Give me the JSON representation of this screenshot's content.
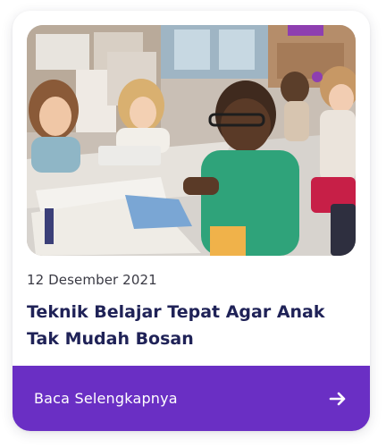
{
  "article": {
    "image_alt": "classroom-children-studying",
    "date": "12 Desember 2021",
    "title": "Teknik Belajar Tepat Agar Anak Tak Mudah Bosan",
    "cta_label": "Baca Selengkapnya",
    "cta_icon": "arrow-right-icon"
  },
  "colors": {
    "accent": "#6a2fc4",
    "title": "#1f2257",
    "date": "#3a3a44"
  }
}
